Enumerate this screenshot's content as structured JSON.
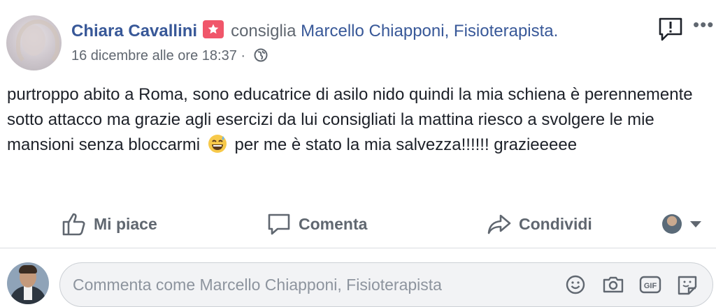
{
  "post": {
    "author": "Chiara Cavallini",
    "verb": "consiglia",
    "target": "Marcello Chiapponi, Fisioterapista.",
    "timestamp": "16 dicembre alle ore 18:37 ·",
    "text_part1": "purtroppo abito a Roma, sono educatrice di asilo nido quindi la mia schiena è perennemente sotto attacco ma grazie agli esercizi da lui consigliati la mattina riesco a svolgere le mie mansioni senza bloccarmi",
    "text_part2": "per me è stato la mia salvezza!!!!!! grazieeeee",
    "badge_icon": "star-badge-icon",
    "badge_color": "#f0566a",
    "privacy_icon": "globe-icon"
  },
  "actions": {
    "like_label": "Mi piace",
    "comment_label": "Comenta",
    "share_label": "Condividi"
  },
  "comment": {
    "placeholder": "Commenta come Marcello Chiapponi, Fisioterapista"
  },
  "colors": {
    "link": "#385898",
    "secondary": "#606770",
    "text": "#1d2129"
  }
}
